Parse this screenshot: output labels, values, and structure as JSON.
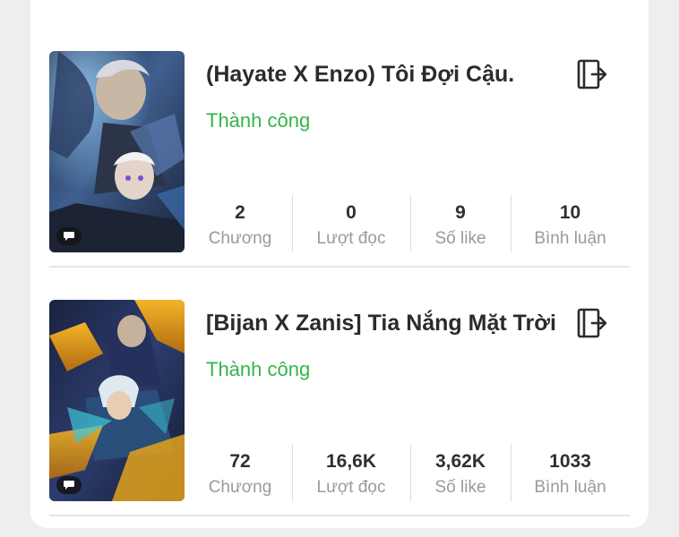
{
  "stories": [
    {
      "title": "(Hayate X Enzo) Tôi Đợi Cậu.",
      "status": "Thành công",
      "stats": [
        {
          "value": "2",
          "label": "Chương"
        },
        {
          "value": "0",
          "label": "Lượt đọc"
        },
        {
          "value": "9",
          "label": "Số like"
        },
        {
          "value": "10",
          "label": "Bình luận"
        }
      ]
    },
    {
      "title": "[Bijan X Zanis] Tia Nắng Mặt Trời",
      "status": "Thành công",
      "stats": [
        {
          "value": "72",
          "label": "Chương"
        },
        {
          "value": "16,6K",
          "label": "Lượt đọc"
        },
        {
          "value": "3,62K",
          "label": "Số like"
        },
        {
          "value": "1033",
          "label": "Bình luận"
        }
      ]
    }
  ],
  "icons": {
    "export": "export-icon",
    "comment_badge": "comment-bubble-icon"
  },
  "colors": {
    "status_success": "#35b44a",
    "title": "#2b2b2b",
    "label": "#9a9a9a"
  }
}
